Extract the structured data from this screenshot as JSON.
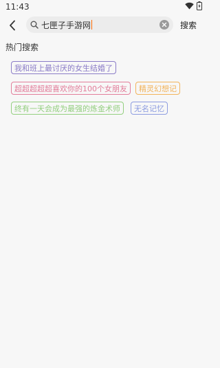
{
  "status": {
    "time": "11:43"
  },
  "search": {
    "value": "七匣子手游网",
    "button_label": "搜索"
  },
  "hot": {
    "title": "热门搜索",
    "tags": [
      {
        "label": "我和班上最讨厌的女生结婚了",
        "color": "#8a7bc7"
      },
      {
        "label": "超超超超超喜欢你的100个女朋友",
        "color": "#e27d9a"
      },
      {
        "label": "精灵幻想记",
        "color": "#f2b35a"
      },
      {
        "label": "终有一天会成为最强的炼金术师",
        "color": "#93cf7f"
      },
      {
        "label": "无名记忆",
        "color": "#8b9be0"
      }
    ]
  }
}
